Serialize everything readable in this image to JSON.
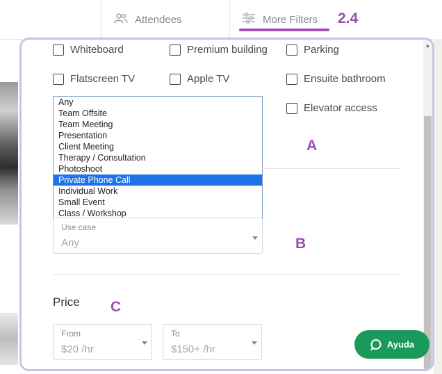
{
  "header": {
    "tabs": [
      {
        "label": "Attendees",
        "icon": "people-icon"
      },
      {
        "label": "More Filters",
        "icon": "sliders-icon"
      }
    ],
    "annotation": "2.4"
  },
  "amenities": [
    {
      "label": "Whiteboard",
      "checked": false
    },
    {
      "label": "Premium building",
      "checked": false
    },
    {
      "label": "Parking",
      "checked": false
    },
    {
      "label": "Flatscreen TV",
      "checked": false
    },
    {
      "label": "Apple TV",
      "checked": false
    },
    {
      "label": "Ensuite bathroom",
      "checked": false
    },
    {
      "label": "Elevator access",
      "checked": false
    }
  ],
  "use_case_list": {
    "options": [
      "Any",
      "Team Offsite",
      "Team Meeting",
      "Presentation",
      "Client Meeting",
      "Therapy / Consultation",
      "Photoshoot",
      "Private Phone Call",
      "Individual Work",
      "Small Event",
      "Class / Workshop"
    ],
    "selected": "Private Phone Call"
  },
  "use_case": {
    "label": "Use case",
    "value": "Any"
  },
  "price": {
    "title": "Price",
    "from": {
      "label": "From",
      "value": "$20 /hr"
    },
    "to": {
      "label": "To",
      "value": "$150+ /hr"
    }
  },
  "annotations": {
    "a": "A",
    "b": "B",
    "c": "C"
  },
  "chat": {
    "label": "Ayuda",
    "color": "#1a9a5a"
  },
  "colors": {
    "accent": "#9b4fb0",
    "selected": "#1e73e8",
    "frame": "#c8c3e3"
  }
}
